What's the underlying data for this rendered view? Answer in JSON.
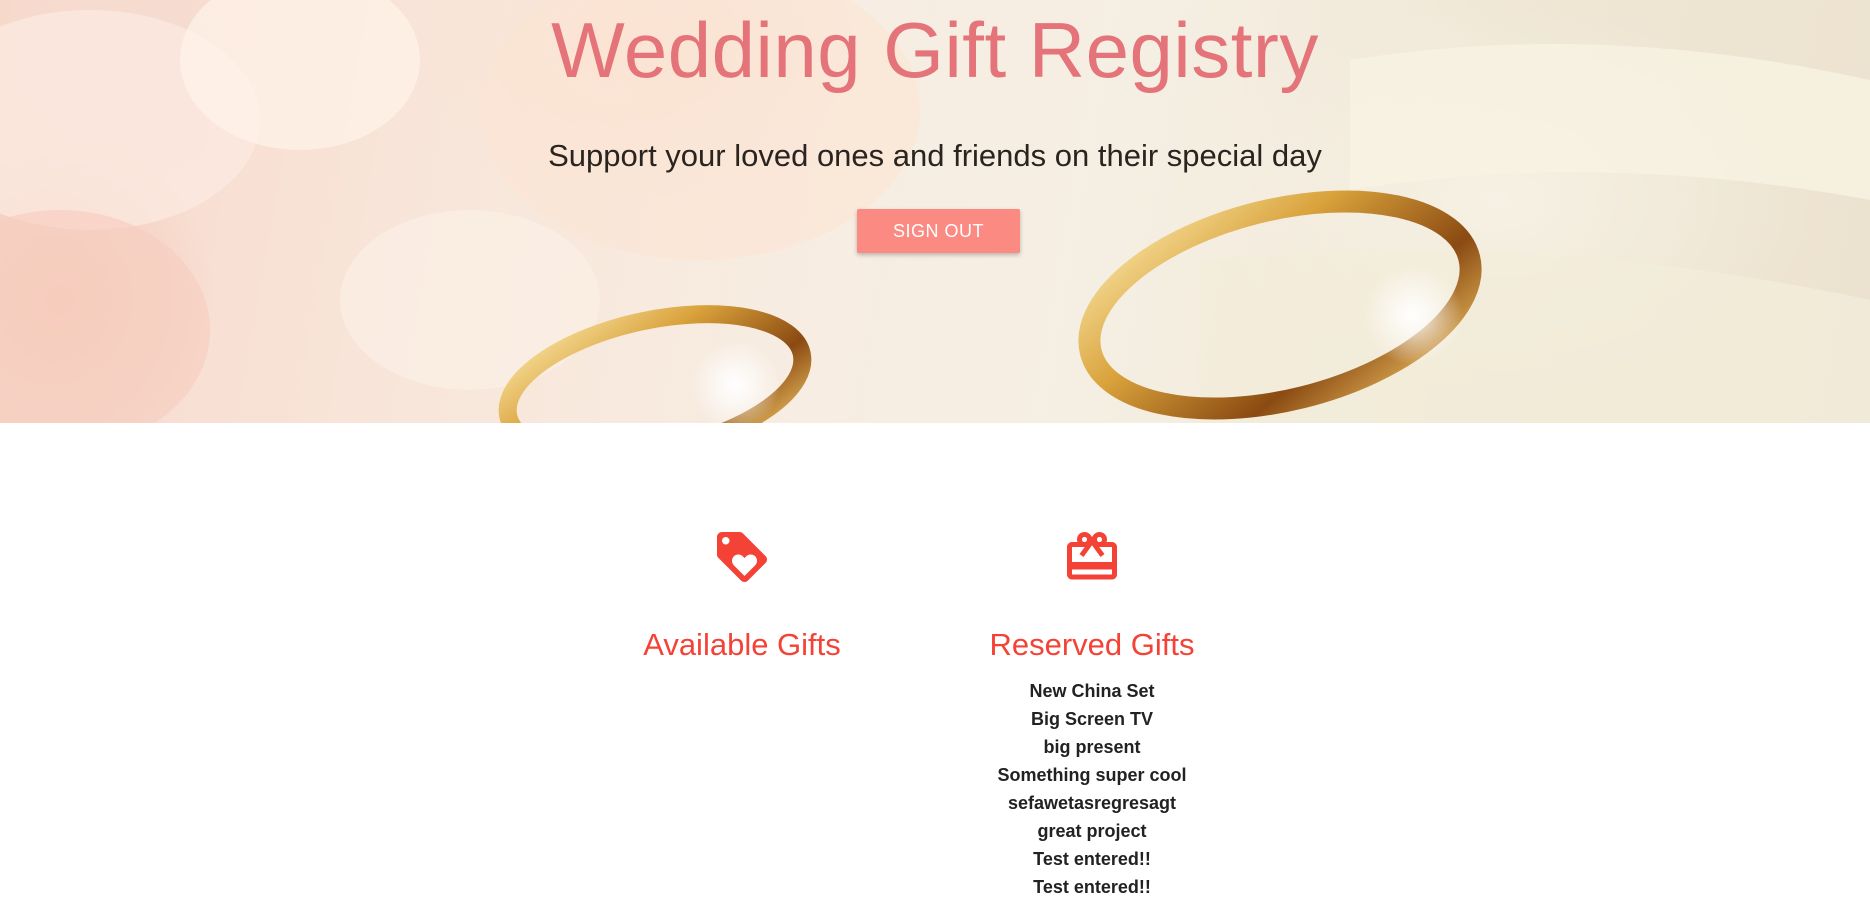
{
  "hero": {
    "title": "Wedding Gift Registry",
    "subtitle": "Support your loved ones and friends on their special day",
    "signout_label": "SIGN OUT"
  },
  "available": {
    "icon": "heart-tag-icon",
    "heading": "Available Gifts",
    "items": []
  },
  "reserved": {
    "icon": "gift-card-icon",
    "heading": "Reserved Gifts",
    "items": [
      "New China Set",
      "Big Screen TV",
      "big present",
      "Something super cool",
      "sefawetasregresagt",
      "great project",
      "Test entered!!",
      "Test entered!!"
    ]
  },
  "colors": {
    "title": "#e4747a",
    "accent": "#f44336",
    "button": "#fb8a82"
  }
}
